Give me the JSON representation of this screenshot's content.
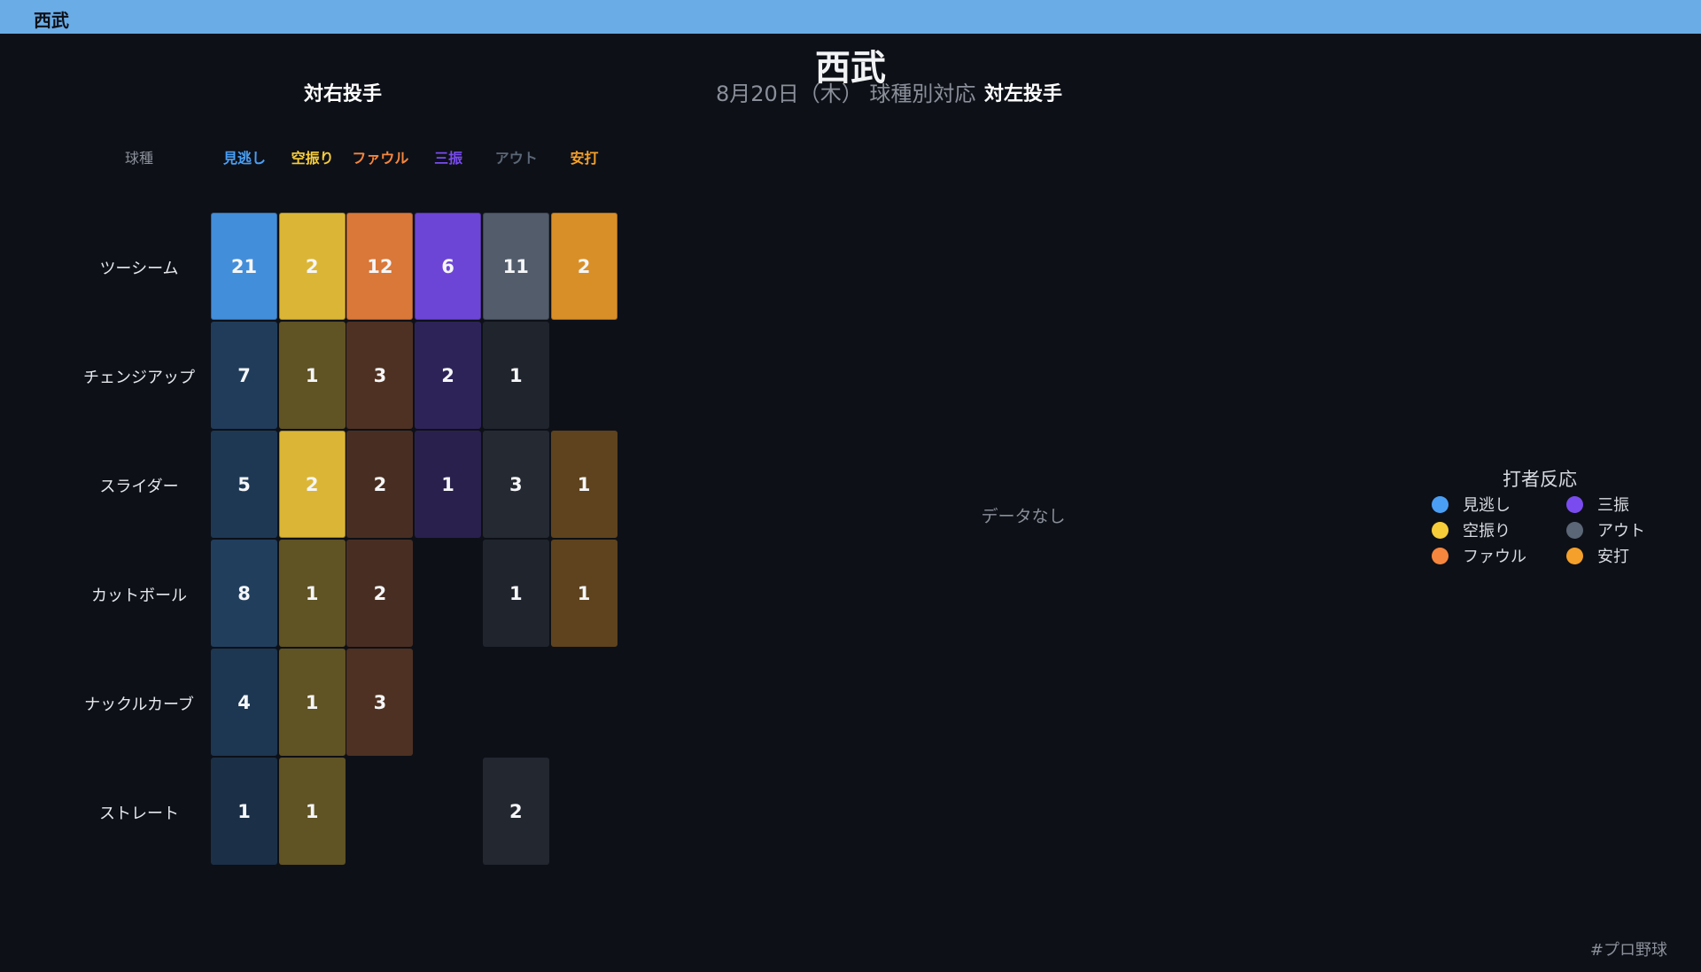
{
  "topbar": {
    "title": "西武"
  },
  "title": "西武",
  "subtitle": "8月20日（木） 球種別対応",
  "hashtag": "#プロ野球",
  "chart_data": {
    "type": "heatmap",
    "panels": [
      {
        "title": "対右投手",
        "row_header": "球種",
        "columns": [
          {
            "label": "見逃し",
            "color": "#4a9ff5"
          },
          {
            "label": "空振り",
            "color": "#f7cd3a"
          },
          {
            "label": "ファウル",
            "color": "#f5863e"
          },
          {
            "label": "三振",
            "color": "#7a4cf0"
          },
          {
            "label": "アウト",
            "color": "#5b6676"
          },
          {
            "label": "安打",
            "color": "#f5a02a"
          }
        ],
        "rows": [
          "ツーシーム",
          "チェンジアップ",
          "スライダー",
          "カットボール",
          "ナックルカーブ",
          "ストレート"
        ],
        "values": [
          [
            21,
            2,
            12,
            6,
            11,
            2
          ],
          [
            7,
            1,
            3,
            2,
            1,
            null
          ],
          [
            5,
            2,
            2,
            1,
            3,
            1
          ],
          [
            8,
            1,
            2,
            null,
            1,
            1
          ],
          [
            4,
            1,
            3,
            null,
            null,
            null
          ],
          [
            1,
            1,
            null,
            null,
            2,
            null
          ]
        ]
      },
      {
        "title": "対左投手",
        "empty_text": "データなし"
      }
    ],
    "legend": {
      "title": "打者反応",
      "items": [
        {
          "label": "見逃し",
          "color": "#4a9ff5"
        },
        {
          "label": "三振",
          "color": "#7a4cf0"
        },
        {
          "label": "空振り",
          "color": "#f7cd3a"
        },
        {
          "label": "アウト",
          "color": "#5b6676"
        },
        {
          "label": "ファウル",
          "color": "#f5863e"
        },
        {
          "label": "安打",
          "color": "#f5a02a"
        }
      ]
    }
  }
}
